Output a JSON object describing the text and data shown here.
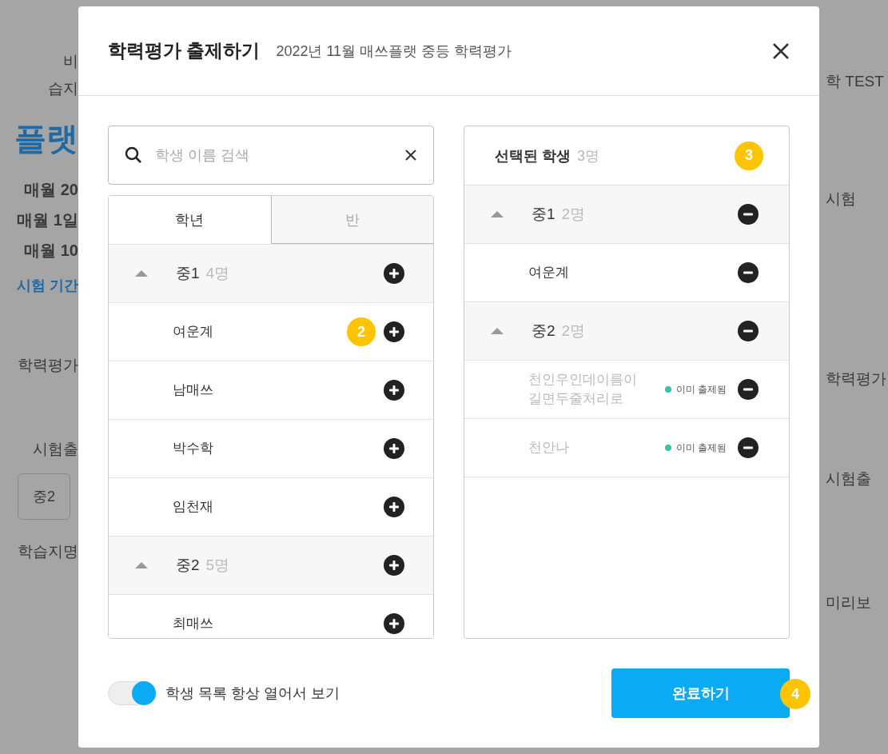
{
  "background": {
    "left": [
      {
        "kind": "label",
        "text": "비"
      },
      {
        "kind": "label",
        "text": "습지"
      },
      {
        "kind": "heading",
        "text": "플랫"
      },
      {
        "kind": "info",
        "text": "매월 20"
      },
      {
        "kind": "info",
        "text": "매월 1일"
      },
      {
        "kind": "info",
        "text": "매월 10"
      },
      {
        "kind": "link",
        "text": "시험 기간"
      },
      {
        "kind": "label",
        "text": "학력평가"
      },
      {
        "kind": "label",
        "text": "시험출"
      },
      {
        "kind": "button",
        "text": "중2"
      },
      {
        "kind": "label",
        "text": "학습지명"
      }
    ],
    "right": [
      {
        "kind": "label",
        "text": "학 TEST"
      },
      {
        "kind": "label",
        "text": "시험"
      },
      {
        "kind": "label",
        "text": "학력평가"
      },
      {
        "kind": "label",
        "text": "시험출"
      },
      {
        "kind": "label",
        "text": "미리보"
      }
    ]
  },
  "modal": {
    "title": "학력평가 출제하기",
    "subtitle": "2022년 11월 매쓰플랫 중등 학력평가"
  },
  "search": {
    "placeholder": "학생 이름 검색"
  },
  "tabs": [
    {
      "label": "학년",
      "selected": true
    },
    {
      "label": "반",
      "selected": false
    }
  ],
  "groups": [
    {
      "name": "중1",
      "count": "4명",
      "expanded": true,
      "children": [
        {
          "name": "여운계",
          "badge": "2"
        },
        {
          "name": "남매쓰"
        },
        {
          "name": "박수학"
        },
        {
          "name": "임천재"
        }
      ]
    },
    {
      "name": "중2",
      "count": "5명",
      "expanded": true,
      "children": [
        {
          "name": "최매쓰"
        }
      ]
    }
  ],
  "selected_panel": {
    "title": "선택된 학생",
    "count": "3명",
    "badge": "3",
    "groups": [
      {
        "name": "중1",
        "count": "2명",
        "expanded": true,
        "children": [
          {
            "name": "여운계",
            "disabled": false
          }
        ]
      },
      {
        "name": "중2",
        "count": "2명",
        "expanded": true,
        "children": [
          {
            "name": "천인우인데이름이길면두줄처리로",
            "disabled": true,
            "status": "이미 출제됨"
          },
          {
            "name": "천안나",
            "disabled": true,
            "status": "이미 출제됨"
          }
        ]
      }
    ]
  },
  "toggle": {
    "label": "학생 목록 항상 열어서 보기",
    "on": true
  },
  "done_button": {
    "label": "완료하기",
    "badge": "4"
  }
}
